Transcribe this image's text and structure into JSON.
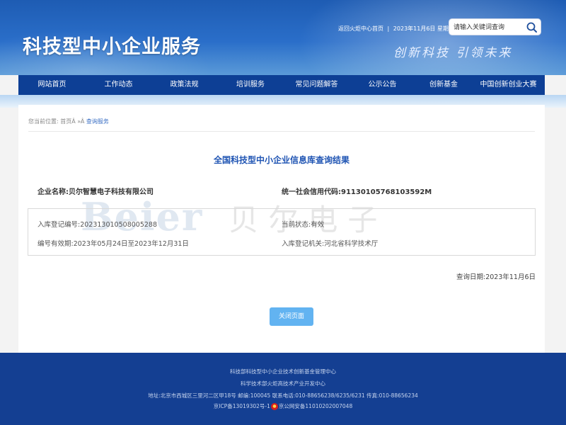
{
  "header": {
    "site_title": "科技型中小企业服务",
    "top_links": {
      "home_link": "返回火炬中心首页",
      "date": "2023年11月6日",
      "weekday": "星期一"
    },
    "slogan": "创新科技 引领未来",
    "search": {
      "placeholder": "请输入关键词查询",
      "icon": "search-icon"
    }
  },
  "nav": {
    "items": [
      {
        "label": "网站首页"
      },
      {
        "label": "工作动态"
      },
      {
        "label": "政策法规"
      },
      {
        "label": "培训服务"
      },
      {
        "label": "常见问题解答"
      },
      {
        "label": "公示公告"
      },
      {
        "label": "创新基金"
      },
      {
        "label": "中国创新创业大赛"
      }
    ]
  },
  "breadcrumb": {
    "prefix": "您当前位置:",
    "home": "首页Â",
    "sep": "»Â",
    "current": "查询服务"
  },
  "result": {
    "title": "全国科技型中小企业信息库查询结果",
    "company_label": "企业名称:",
    "company_value": "贝尔智慧电子科技有限公司",
    "credit_label": "统一社会信用代码:",
    "credit_value": "91130105768103592M",
    "watermark_latin": "Beier",
    "watermark_cn": "贝尔电子",
    "reg_no_label": "入库登记编号:",
    "reg_no_value": "202313010508005288",
    "status_label": "当前状态:",
    "status_value": "有效",
    "validity_label": "编号有效期:",
    "validity_value": "2023年05月24日至2023年12月31日",
    "authority_label": "入库登记机关:",
    "authority_value": "河北省科学技术厅",
    "query_date_label": "查询日期:",
    "query_date_value": "2023年11月6日",
    "close_button": "关闭页面"
  },
  "footer": {
    "line1": "科技部科技型中小企业技术创新基金管理中心",
    "line2": "科学技术部火炬高技术产业开发中心",
    "line3": "地址:北京市西城区三里河二区甲18号 邮编:100045 联系电话:010-88656238/6235/6231 传真:010-88656234",
    "icp": "京ICP备13019302号-1",
    "police": "京公网安备11010202007048",
    "police_icon": "police-badge-icon"
  },
  "colors": {
    "nav": "#0d3f95",
    "footer": "#143f92",
    "title": "#1f54b3",
    "button": "#62b3f1"
  }
}
